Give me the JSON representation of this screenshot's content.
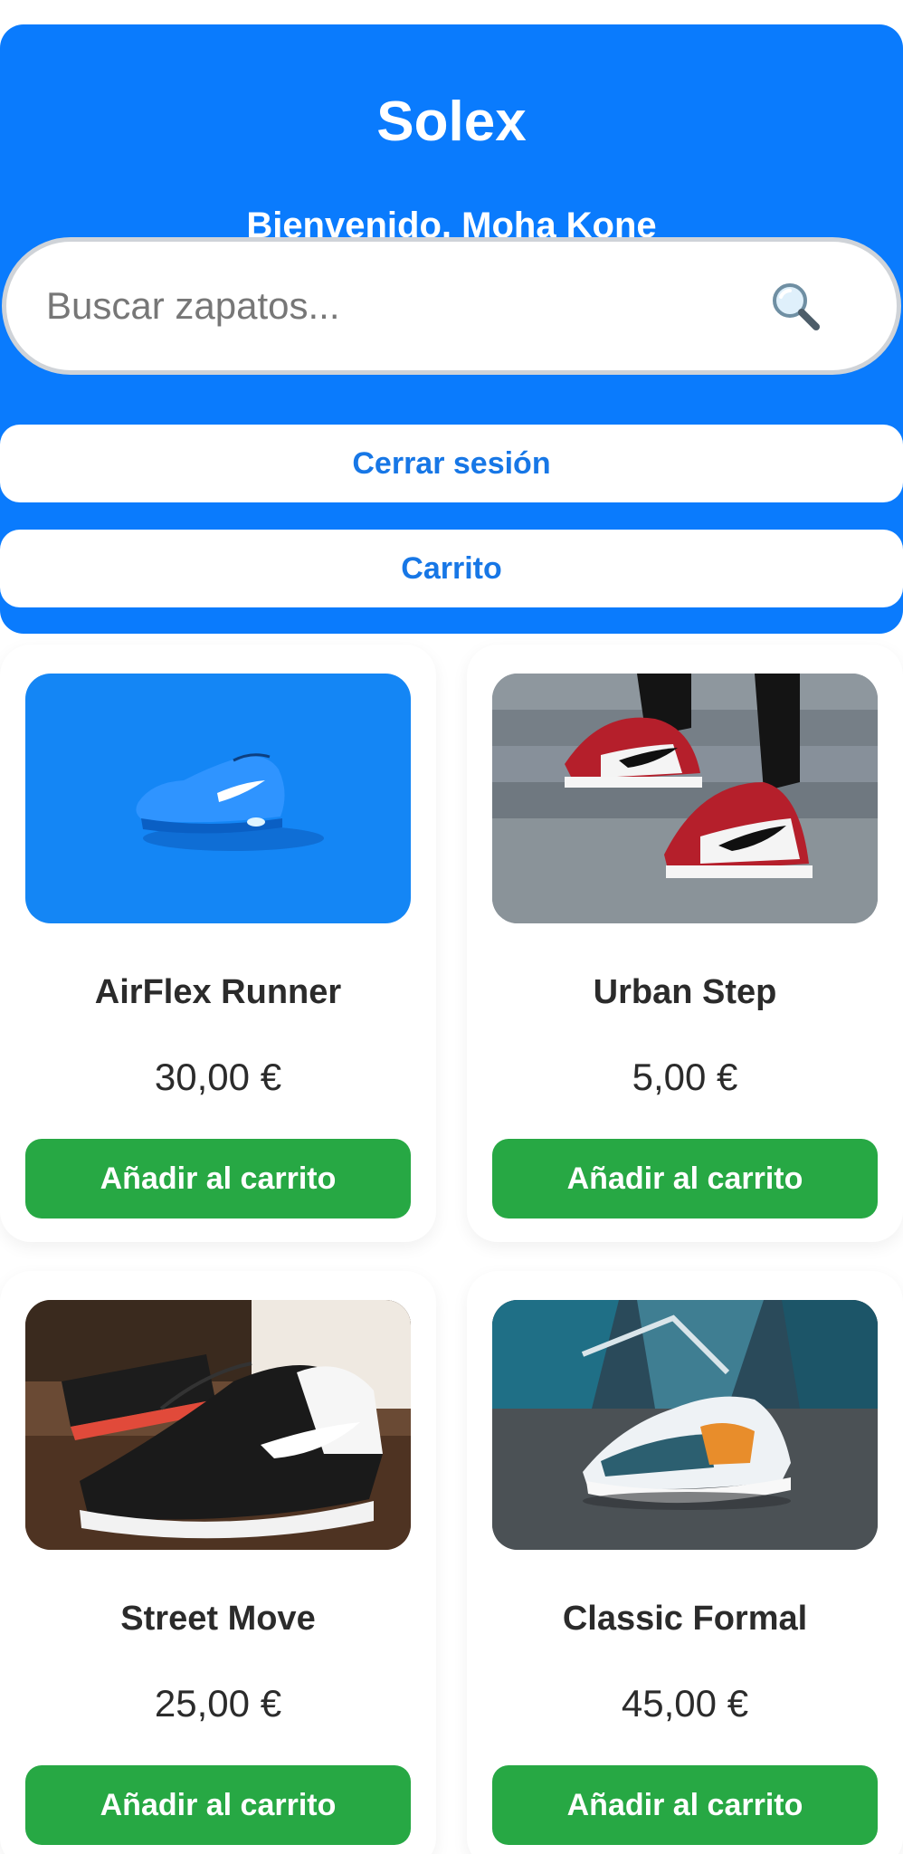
{
  "header": {
    "title": "Solex",
    "welcome": "Bienvenido, Moha Kone",
    "search_placeholder": "Buscar zapatos...",
    "logout_label": "Cerrar sesión",
    "cart_label": "Carrito"
  },
  "colors": {
    "brand_blue": "#0a7bfd",
    "link_blue": "#1777e6",
    "add_green": "#27a844"
  },
  "products": [
    {
      "name": "AirFlex Runner",
      "price": "30,00 €",
      "button": "Añadir al carrito"
    },
    {
      "name": "Urban Step",
      "price": "5,00 €",
      "button": "Añadir al carrito"
    },
    {
      "name": "Street Move",
      "price": "25,00 €",
      "button": "Añadir al carrito"
    },
    {
      "name": "Classic Formal",
      "price": "45,00 €",
      "button": "Añadir al carrito"
    }
  ]
}
